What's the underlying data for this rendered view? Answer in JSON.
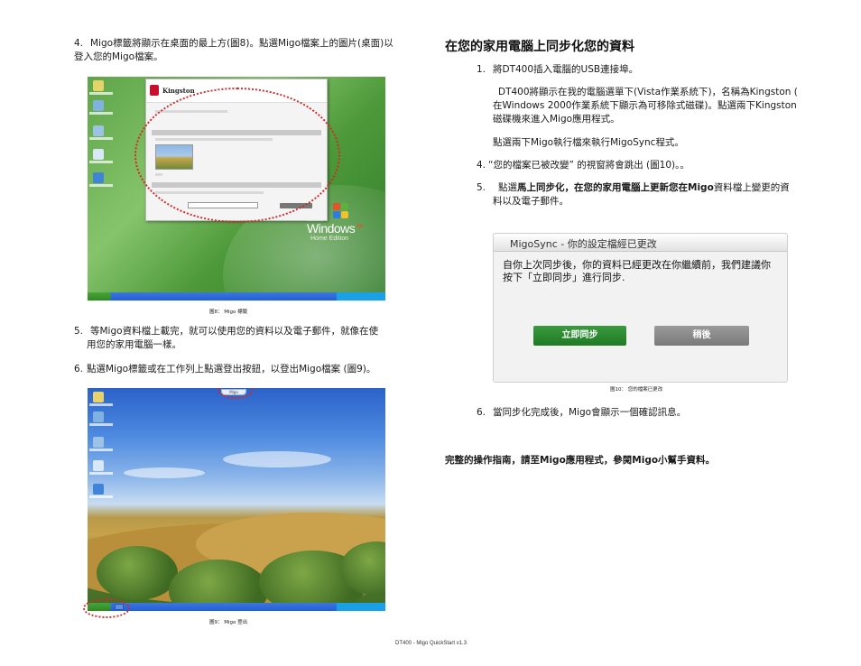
{
  "left_column": {
    "step4": {
      "number": "4.",
      "line1": "Migo標籤將顯示在桌面的最上方(圖8)。點選Migo檔案上的圖片(桌面)以",
      "line2": "登入您的Migo檔案。"
    },
    "figure8": {
      "caption": "圖8： Migo 標籤",
      "migo_window_brand": "Kingston",
      "xp_logo_small": "Microsoft",
      "xp_logo_word": "Windows",
      "xp_logo_edition": "Home Edition",
      "xp_logo_suffix": "xp"
    },
    "step5": {
      "number": "5.",
      "line1": "等Migo資料檔上載完，就可以使用您的資料以及電子郵件，就像在使",
      "line2": "用您的家用電腦一樣。"
    },
    "step6": {
      "number": "6.",
      "text": "點選Migo標籤或在工作列上點選登出按鈕，以登出Migo檔案 (圖9)。"
    },
    "figure9": {
      "caption": "圖9： Migo 登出",
      "tab_label": "Migo"
    }
  },
  "right_column": {
    "heading": "在您的家用電腦上同步化您的資料",
    "step1": {
      "number": "1.",
      "text": "將DT400插入電腦的USB連接埠。"
    },
    "para1": {
      "line1": "DT400將顯示在我的電腦選單下(Vista作業系統下)，名稱為Kingston (",
      "line2": "在Windows 2000作業系統下顯示為可移除式磁碟)。點選兩下Kingston",
      "line3": "磁碟機來進入Migo應用程式。"
    },
    "para2": "點選兩下Migo執行檔來執行MigoSync程式。",
    "step4": {
      "number": "4.",
      "text": "“您的檔案已被改變” 的視窗將會跳出 (圖10)。。"
    },
    "step5": {
      "number": "5.",
      "pre": "點選",
      "bold1": "馬上同步化，在您的家用電腦上更新您在Migo",
      "rest1": "資料檔上變更的資",
      "line2": "料以及電子郵件。"
    },
    "dialog": {
      "title": "MigoSync - 你的設定檔經已更改",
      "message_line1": "自你上次同步後，你的資料已經更改在你繼續前，我們建議你",
      "message_line2": "按下「立即同步」進行同步.",
      "sync_button": "立即同步",
      "later_button": "稍後"
    },
    "figure10_caption": "圖10： 您的檔案已更改",
    "step6": {
      "number": "6.",
      "text": "當同步化完成後，Migo會顯示一個確認訊息。"
    },
    "closing": "完整的操作指南，請至Migo應用程式，參閱Migo小幫手資料。"
  },
  "footer": "DT400 - Migo QuickStart v1.3"
}
